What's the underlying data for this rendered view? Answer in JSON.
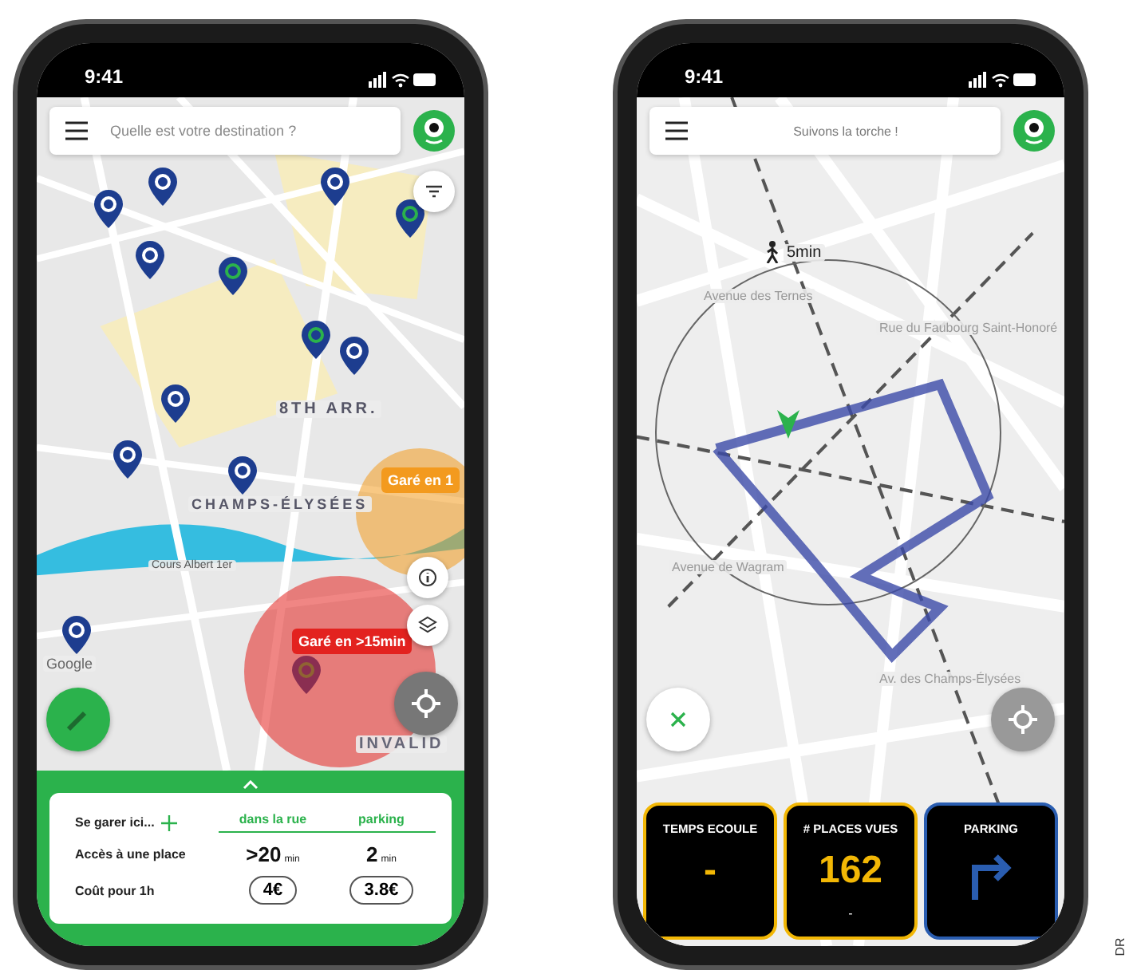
{
  "map_phone": {
    "time": "9:41",
    "search": {
      "placeholder": "Quelle est votre destination ?"
    },
    "map_labels": [
      "8TH ARR.",
      "CHAMPS-ÉLYSÉES",
      "Cours Albert 1er",
      "INVALID",
      "Google"
    ],
    "badges": [
      {
        "text": "Garé en 1",
        "color": "#f39a1e"
      },
      {
        "text": "Garé en >15min",
        "color": "#e3221f"
      }
    ],
    "panel": {
      "row_header": "Se garer ici...",
      "rows": [
        "Accès à une place",
        "Coût pour 1h"
      ],
      "columns": [
        {
          "title": "dans la rue",
          "time": ">20",
          "unit": "min",
          "cost": "4€"
        },
        {
          "title": "parking",
          "time": "2",
          "unit": "min",
          "cost": "3.8€"
        }
      ]
    }
  },
  "guide_phone": {
    "time": "9:41",
    "title": "Suivons la torche !",
    "walk": "5min",
    "map_labels": [
      "Avenue des Ternes",
      "Rue du Faubourg Saint-Honoré",
      "Avenue de Wagram",
      "Av. des Champs-Élysées"
    ],
    "tiles": [
      {
        "kind": "text",
        "title": "TEMPS ECOULE",
        "value": "-",
        "color": "#f2b705"
      },
      {
        "kind": "text",
        "title": "# PLACES VUES",
        "value": "162",
        "sub": "-",
        "color": "#f2b705"
      },
      {
        "kind": "arrow",
        "title": "PARKING",
        "color": "#2a5db0"
      }
    ]
  },
  "credit": "DR"
}
